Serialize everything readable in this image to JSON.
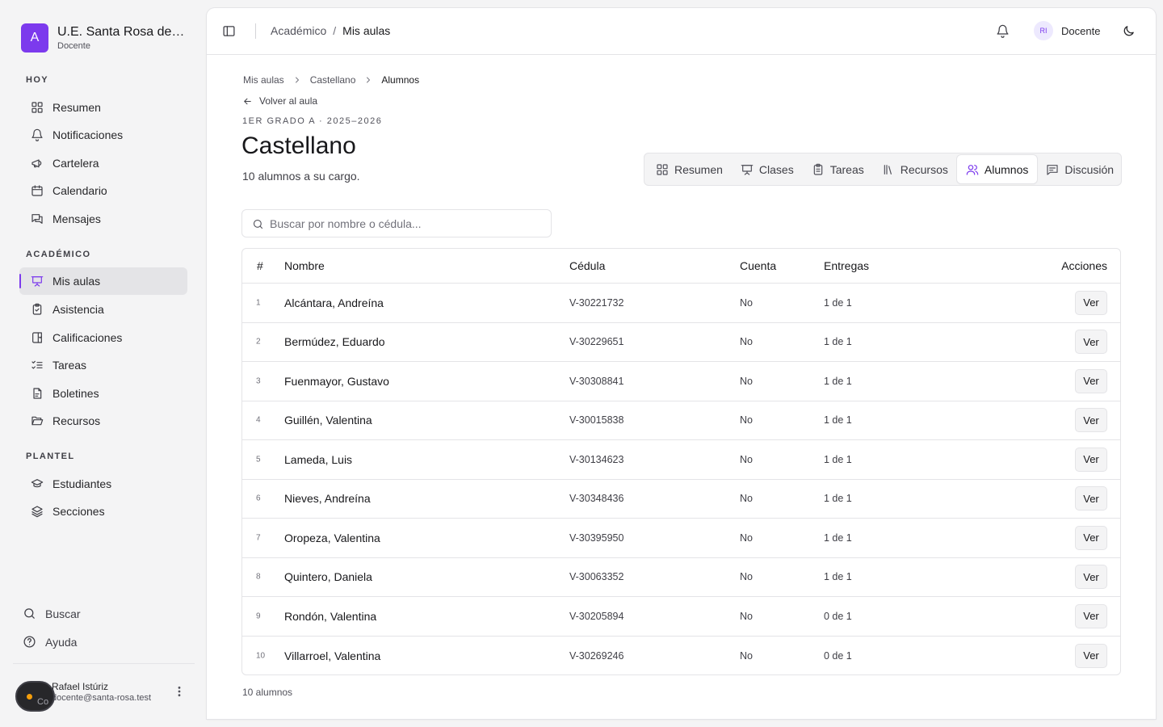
{
  "brand": {
    "logo_letter": "A",
    "name": "U.E. Santa Rosa de Lima",
    "role": "Docente"
  },
  "sidebar": {
    "groups": [
      {
        "label": "HOY",
        "items": [
          {
            "label": "Resumen",
            "icon": "dashboard-icon"
          },
          {
            "label": "Notificaciones",
            "icon": "bell-icon"
          },
          {
            "label": "Cartelera",
            "icon": "megaphone-icon"
          },
          {
            "label": "Calendario",
            "icon": "calendar-icon"
          },
          {
            "label": "Mensajes",
            "icon": "messages-icon"
          }
        ]
      },
      {
        "label": "ACADÉMICO",
        "items": [
          {
            "label": "Mis aulas",
            "icon": "presentation-icon",
            "active": true
          },
          {
            "label": "Asistencia",
            "icon": "clipboard-check-icon"
          },
          {
            "label": "Calificaciones",
            "icon": "book-check-icon"
          },
          {
            "label": "Tareas",
            "icon": "list-checks-icon"
          },
          {
            "label": "Boletines",
            "icon": "file-report-icon"
          },
          {
            "label": "Recursos",
            "icon": "folder-open-icon"
          }
        ]
      },
      {
        "label": "PLANTEL",
        "items": [
          {
            "label": "Estudiantes",
            "icon": "graduation-cap-icon"
          },
          {
            "label": "Secciones",
            "icon": "layers-icon"
          }
        ]
      }
    ],
    "bottom": {
      "search_label": "Buscar",
      "help_label": "Ayuda"
    },
    "user": {
      "name": "Rafael Istúriz",
      "email": "docente@santa-rosa.test"
    },
    "floating_badge_text": "Co"
  },
  "topbar": {
    "breadcrumb": [
      "Académico",
      "Mis aulas"
    ],
    "avatar_initials": "RI",
    "role": "Docente"
  },
  "page": {
    "breadcrumb": [
      "Mis aulas",
      "Castellano",
      "Alumnos"
    ],
    "back_label": "Volver al aula",
    "eyebrow": "1ER GRADO A · 2025–2026",
    "title": "Castellano",
    "subtitle": "10 alumnos a su cargo.",
    "tabs": [
      {
        "label": "Resumen",
        "icon": "dashboard-icon"
      },
      {
        "label": "Clases",
        "icon": "presentation-icon"
      },
      {
        "label": "Tareas",
        "icon": "clipboard-icon"
      },
      {
        "label": "Recursos",
        "icon": "library-icon"
      },
      {
        "label": "Alumnos",
        "icon": "users-icon",
        "active": true
      },
      {
        "label": "Discusión",
        "icon": "message-square-icon"
      }
    ],
    "search_placeholder": "Buscar por nombre o cédula..."
  },
  "table": {
    "headers": {
      "num": "#",
      "name": "Nombre",
      "cedula": "Cédula",
      "account": "Cuenta",
      "deliveries": "Entregas",
      "actions": "Acciones"
    },
    "action_label": "Ver",
    "rows": [
      {
        "num": "1",
        "name": "Alcántara, Andreína",
        "cedula": "V-30221732",
        "account": "No",
        "deliveries": "1 de 1"
      },
      {
        "num": "2",
        "name": "Bermúdez, Eduardo",
        "cedula": "V-30229651",
        "account": "No",
        "deliveries": "1 de 1"
      },
      {
        "num": "3",
        "name": "Fuenmayor, Gustavo",
        "cedula": "V-30308841",
        "account": "No",
        "deliveries": "1 de 1"
      },
      {
        "num": "4",
        "name": "Guillén, Valentina",
        "cedula": "V-30015838",
        "account": "No",
        "deliveries": "1 de 1"
      },
      {
        "num": "5",
        "name": "Lameda, Luis",
        "cedula": "V-30134623",
        "account": "No",
        "deliveries": "1 de 1"
      },
      {
        "num": "6",
        "name": "Nieves, Andreína",
        "cedula": "V-30348436",
        "account": "No",
        "deliveries": "1 de 1"
      },
      {
        "num": "7",
        "name": "Oropeza, Valentina",
        "cedula": "V-30395950",
        "account": "No",
        "deliveries": "1 de 1"
      },
      {
        "num": "8",
        "name": "Quintero, Daniela",
        "cedula": "V-30063352",
        "account": "No",
        "deliveries": "1 de 1"
      },
      {
        "num": "9",
        "name": "Rondón, Valentina",
        "cedula": "V-30205894",
        "account": "No",
        "deliveries": "0 de 1"
      },
      {
        "num": "10",
        "name": "Villarroel, Valentina",
        "cedula": "V-30269246",
        "account": "No",
        "deliveries": "0 de 1"
      }
    ],
    "footer": "10 alumnos"
  },
  "colors": {
    "accent": "#7c3aed",
    "background": "#f4f4f5",
    "card": "#ffffff",
    "border": "#e4e4e7",
    "warning_dot": "#f59e0b"
  }
}
